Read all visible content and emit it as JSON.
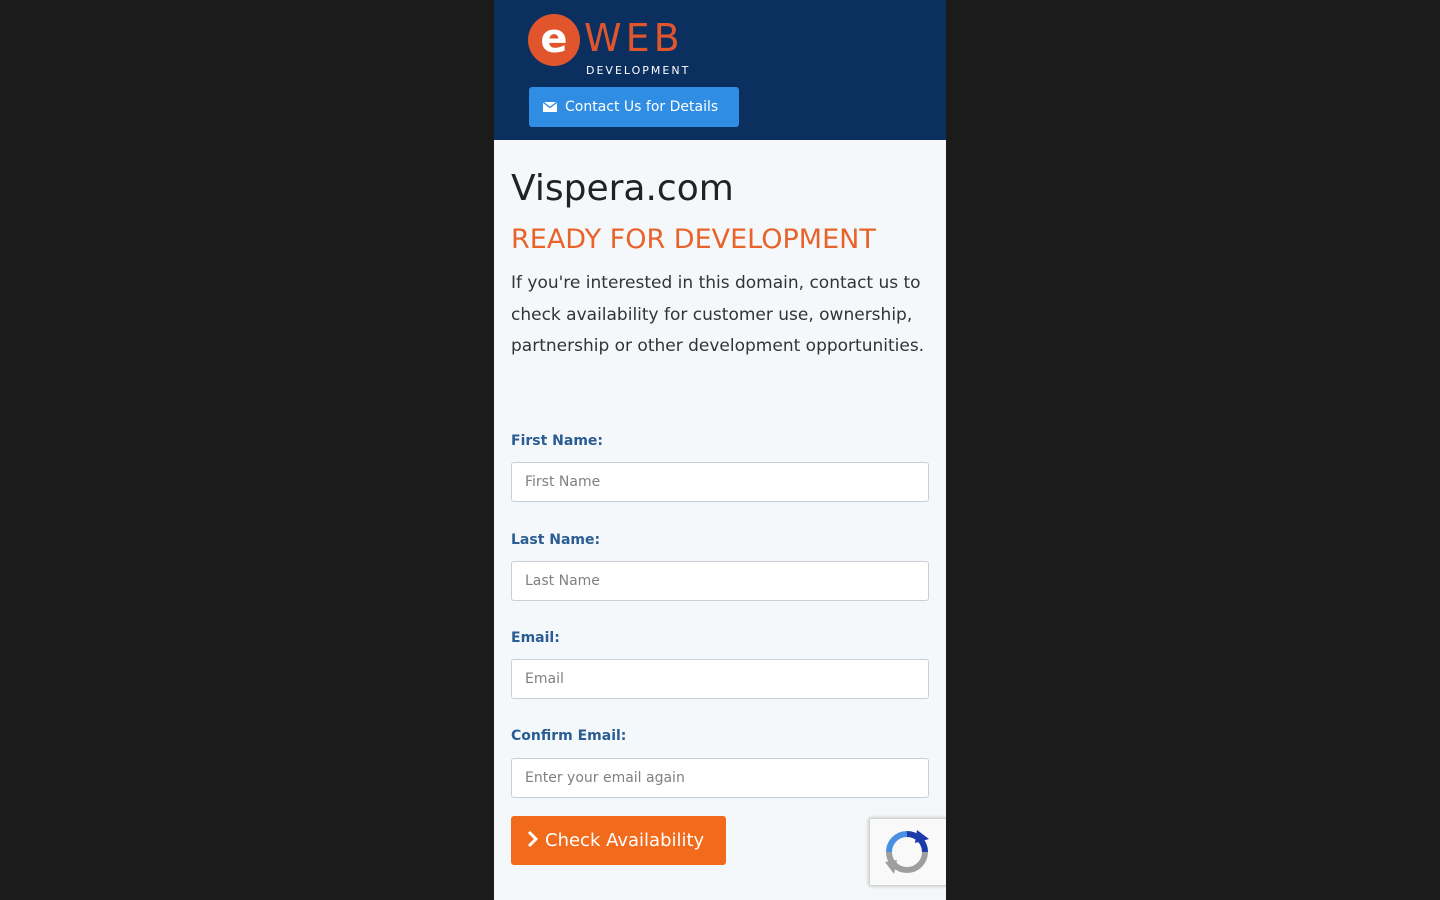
{
  "header": {
    "logo": {
      "mark": "e",
      "word": "WEB",
      "sub": "DEVELOPMENT"
    },
    "contact_button": "Contact Us for Details",
    "background": "#0b3060",
    "accent": "#2f8de4"
  },
  "main": {
    "domain": "Vispera.com",
    "status": "READY FOR DEVELOPMENT",
    "intro": "If you're interested in this domain, contact us to check availability for customer use, ownership, partnership or other development opportunities."
  },
  "form": {
    "first_name": {
      "label": "First Name:",
      "placeholder": "First Name",
      "value": ""
    },
    "last_name": {
      "label": "Last Name:",
      "placeholder": "Last Name",
      "value": ""
    },
    "email": {
      "label": "Email:",
      "placeholder": "Email",
      "value": ""
    },
    "confirm_email": {
      "label": "Confirm Email:",
      "placeholder": "Enter your email again",
      "value": ""
    },
    "submit_label": "Check Availability",
    "submit_color": "#f26a1b"
  },
  "icons": {
    "contact": "envelope-icon",
    "submit": "chevron-right-icon",
    "captcha": "recaptcha-icon"
  }
}
